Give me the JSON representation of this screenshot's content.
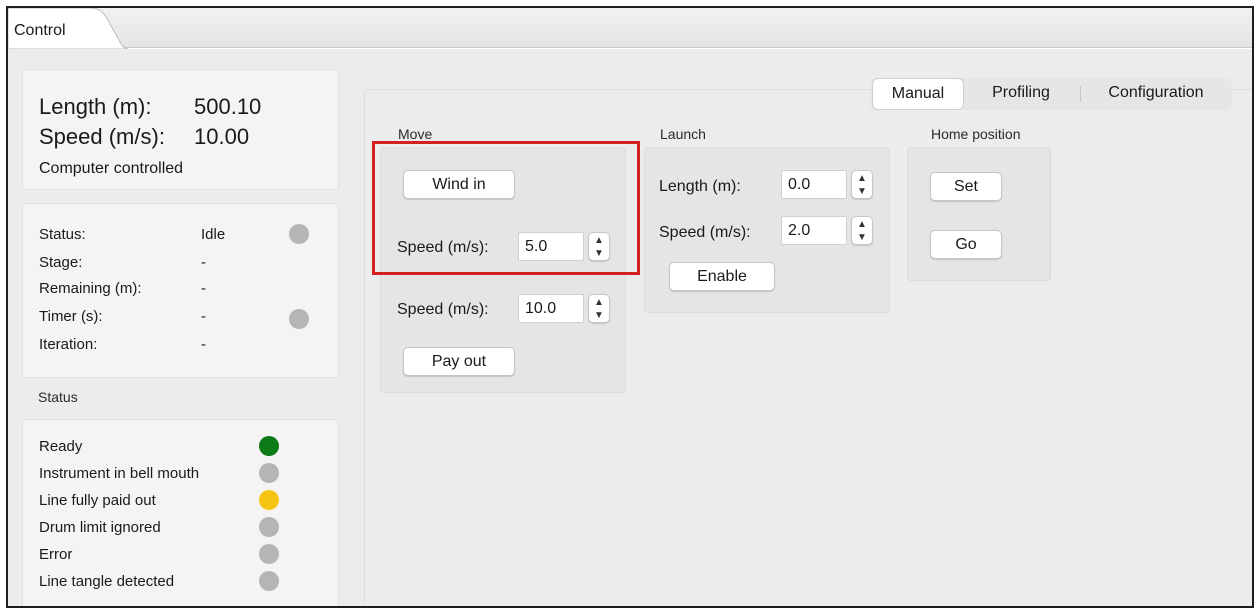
{
  "tabs": {
    "control": "Control"
  },
  "summary": {
    "length_label": "Length (m):",
    "length_value": "500.10",
    "speed_label": "Speed (m/s):",
    "speed_value": "10.00",
    "control_mode": "Computer controlled"
  },
  "status_details": [
    {
      "label": "Status:",
      "value": "Idle"
    },
    {
      "label": "Stage:",
      "value": "-"
    },
    {
      "label": "Remaining (m):",
      "value": "-"
    },
    {
      "label": "Timer (s):",
      "value": "-"
    },
    {
      "label": "Iteration:",
      "value": "-"
    }
  ],
  "status_section_title": "Status",
  "status_lights": [
    {
      "label": "Ready",
      "color": "#0c7a16"
    },
    {
      "label": "Instrument in bell mouth",
      "color": "#b5b5b5"
    },
    {
      "label": "Line fully paid out",
      "color": "#f6c513"
    },
    {
      "label": "Drum limit ignored",
      "color": "#b5b5b5"
    },
    {
      "label": "Error",
      "color": "#b5b5b5"
    },
    {
      "label": "Line tangle detected",
      "color": "#b5b5b5"
    }
  ],
  "mode_tabs": {
    "manual": "Manual",
    "profiling": "Profiling",
    "configuration": "Configuration",
    "selected": "Manual"
  },
  "move": {
    "title": "Move",
    "wind_in_label": "Wind in",
    "wind_in_speed_label": "Speed (m/s):",
    "wind_in_speed_value": "5.0",
    "pay_out_speed_label": "Speed (m/s):",
    "pay_out_speed_value": "10.0",
    "pay_out_label": "Pay out"
  },
  "launch": {
    "title": "Launch",
    "length_label": "Length (m):",
    "length_value": "0.0",
    "speed_label": "Speed (m/s):",
    "speed_value": "2.0",
    "enable_label": "Enable"
  },
  "home": {
    "title": "Home position",
    "set_label": "Set",
    "go_label": "Go"
  },
  "highlight_color": "#d61f1f"
}
